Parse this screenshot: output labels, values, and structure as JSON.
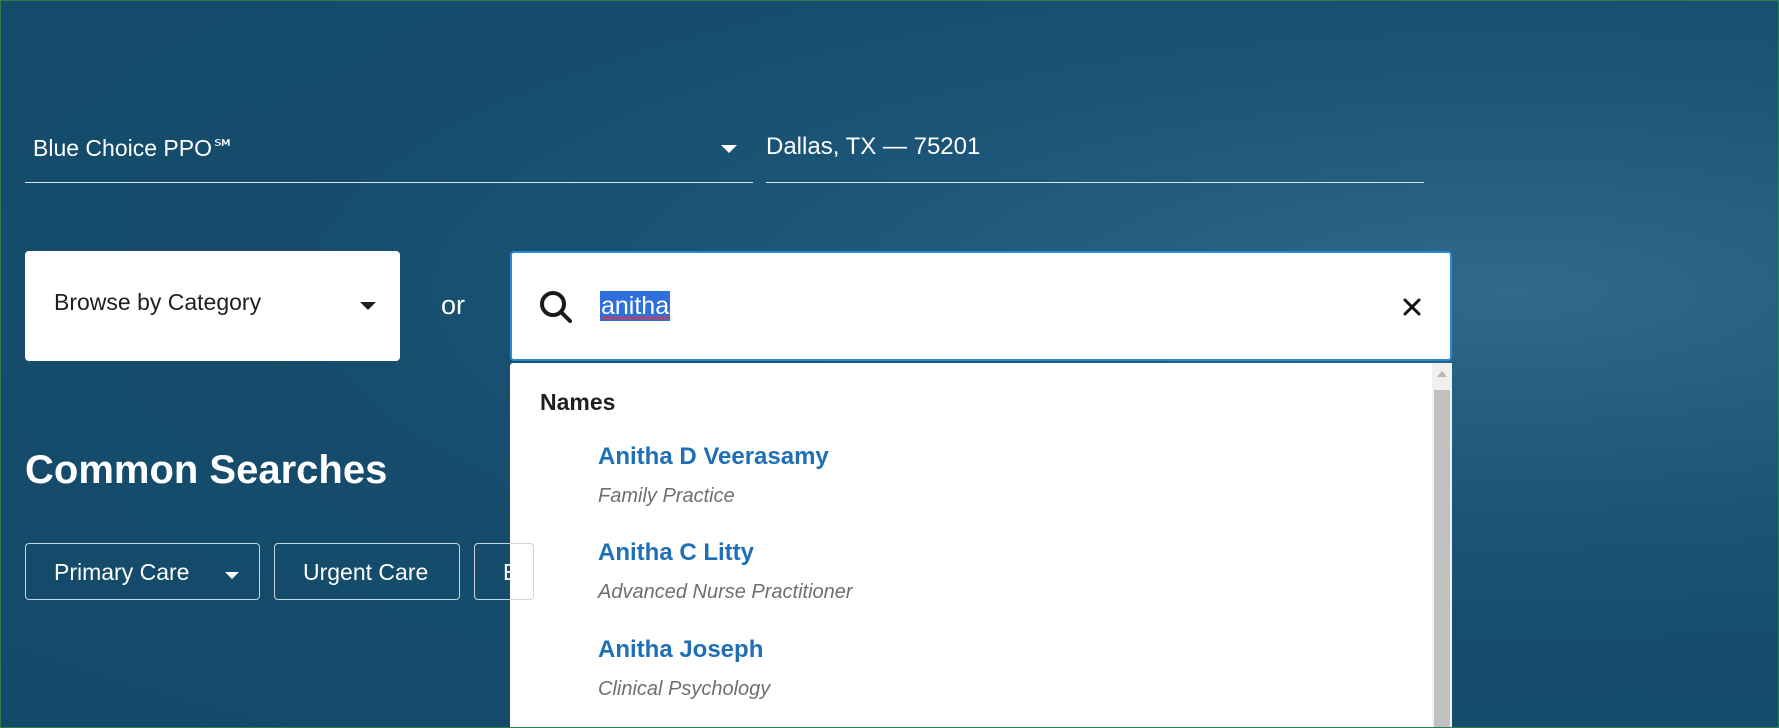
{
  "plan": {
    "selected": "Blue Choice PPO℠"
  },
  "location": {
    "value": "Dallas, TX — 75201"
  },
  "browse": {
    "label": "Browse by Category"
  },
  "or_label": "or",
  "search": {
    "value": "anitha"
  },
  "dropdown": {
    "heading": "Names",
    "results": [
      {
        "name": "Anitha D Veerasamy",
        "specialty": "Family Practice"
      },
      {
        "name": "Anitha C Litty",
        "specialty": "Advanced Nurse Practitioner"
      },
      {
        "name": "Anitha Joseph",
        "specialty": "Clinical Psychology"
      }
    ]
  },
  "common": {
    "title": "Common Searches",
    "chips": [
      {
        "label": "Primary Care"
      },
      {
        "label": "Urgent Care"
      },
      {
        "label": "E"
      }
    ]
  },
  "icons": {
    "search": "search-icon",
    "clear": "close-icon",
    "dropdown_caret": "caret-down-icon"
  },
  "colors": {
    "background": "#154c6c",
    "link": "#1e6fb5",
    "focus_border": "#2a8ad6",
    "selection": "#2f6fdb"
  }
}
